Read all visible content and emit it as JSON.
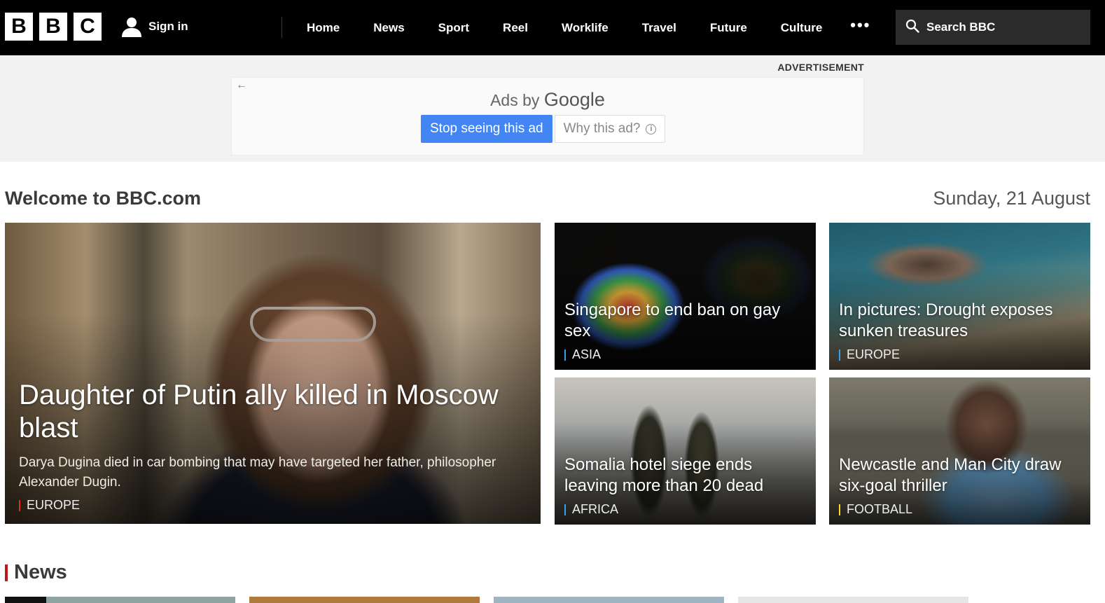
{
  "header": {
    "logo_letters": [
      "B",
      "B",
      "C"
    ],
    "signin_label": "Sign in",
    "nav": [
      "Home",
      "News",
      "Sport",
      "Reel",
      "Worklife",
      "Travel",
      "Future",
      "Culture"
    ],
    "more_label": "•••",
    "search_label": "Search BBC"
  },
  "ad": {
    "label": "ADVERTISEMENT",
    "back_arrow": "←",
    "ads_by": "Ads by",
    "google": "Google",
    "stop_label": "Stop seeing this ad",
    "why_label": "Why this ad?",
    "info_glyph": "i"
  },
  "welcome": {
    "title": "Welcome to BBC.com",
    "date": "Sunday, 21 August"
  },
  "stories": {
    "main": {
      "headline": "Daughter of Putin ally killed in Moscow blast",
      "summary": "Darya Dugina died in car bombing that may have targeted her father, philosopher Alexander Dugin.",
      "tag": "EUROPE",
      "tag_color": "#e02d1c"
    },
    "a": {
      "headline": "Singapore to end ban on gay sex",
      "tag": "ASIA",
      "tag_color": "#3aa1e8"
    },
    "b": {
      "headline": "In pictures: Drought exposes sunken treasures",
      "tag": "EUROPE",
      "tag_color": "#3aa1e8"
    },
    "c": {
      "headline": "Somalia hotel siege ends leaving more than 20 dead",
      "tag": "AFRICA",
      "tag_color": "#3aa1e8"
    },
    "d": {
      "headline": "Newcastle and Man City draw six-goal thriller",
      "tag": "FOOTBALL",
      "tag_color": "#ffd230"
    }
  },
  "section": {
    "news_title": "News",
    "accent": "#bb1919"
  }
}
